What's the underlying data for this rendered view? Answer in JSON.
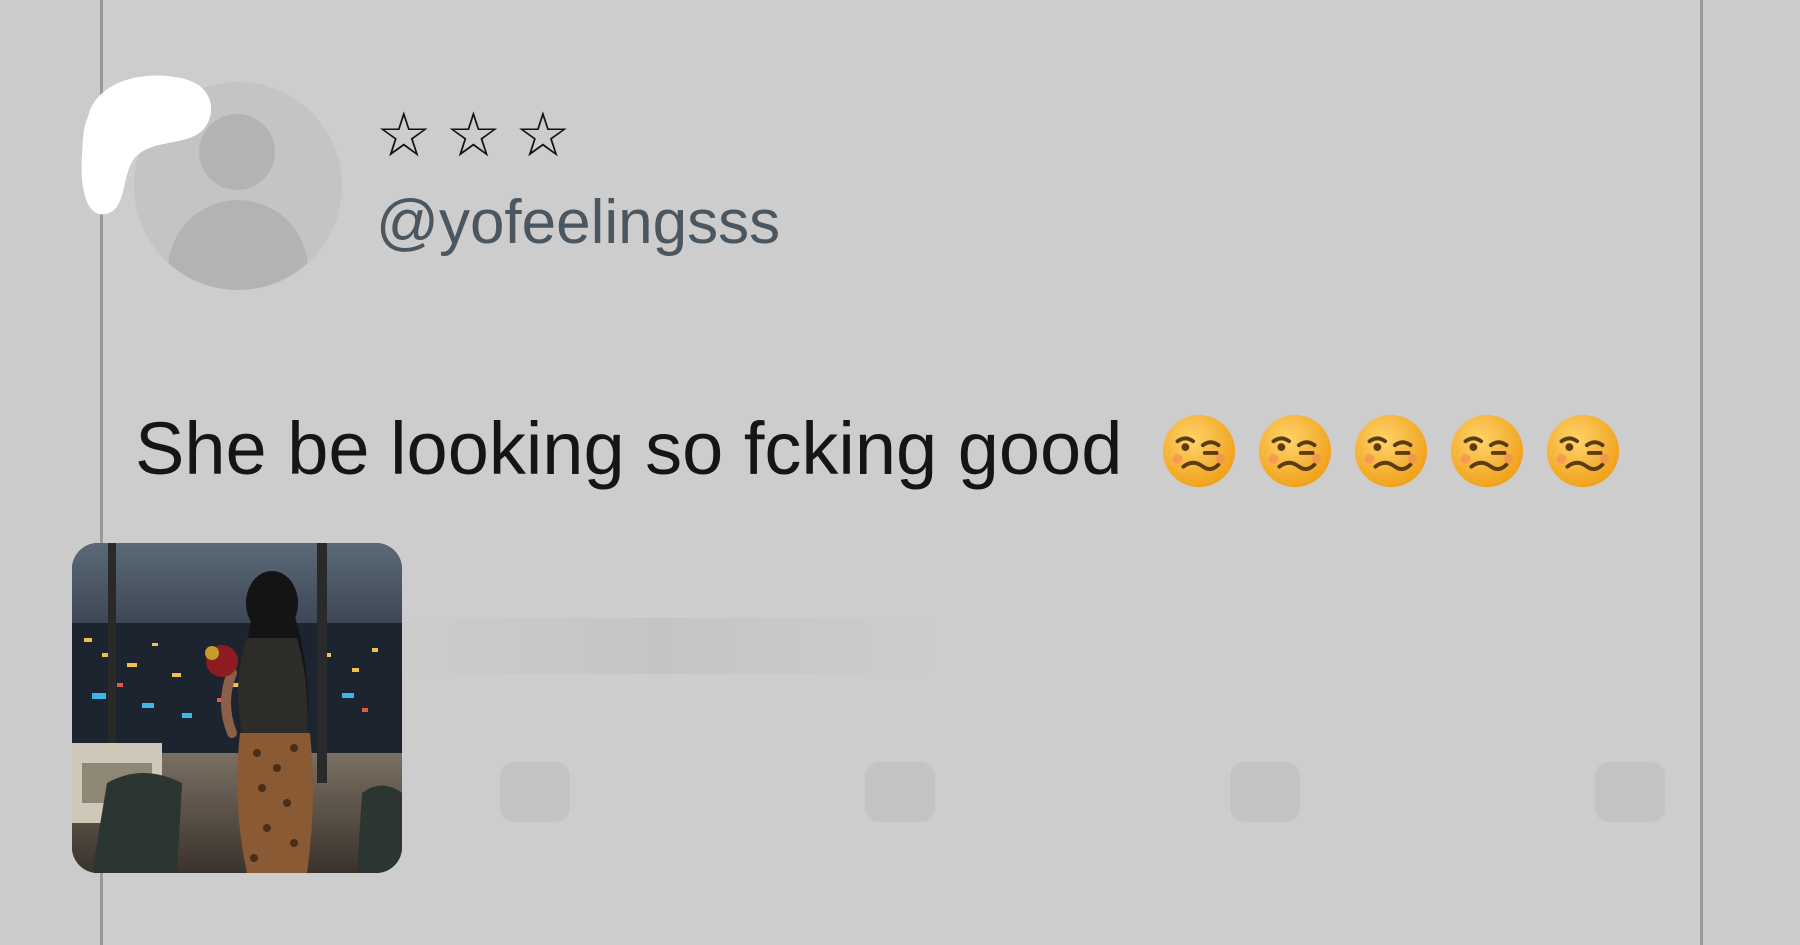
{
  "tweet": {
    "display_name": "☆☆☆",
    "handle": "@yofeelingsss",
    "text": "She be looking so fcking good",
    "emoji_count": 5
  },
  "icons": {
    "avatar": "default-avatar-icon",
    "emoji": "woozy-face-icon"
  },
  "colors": {
    "background": "#cbcbcb",
    "text": "#151515",
    "handle": "#4a5660"
  }
}
